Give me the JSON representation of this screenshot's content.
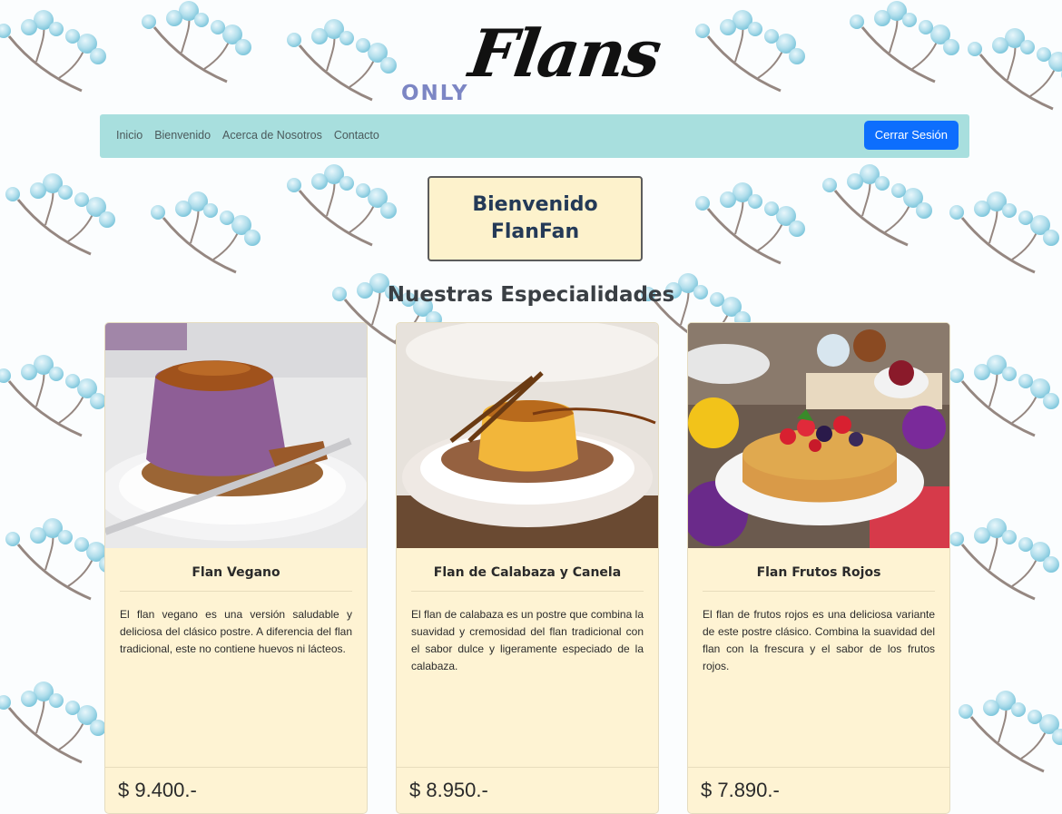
{
  "logo": {
    "prefix": "ONLY",
    "name": "Flans"
  },
  "nav": {
    "links": [
      "Inicio",
      "Bienvenido",
      "Acerca de Nosotros",
      "Contacto"
    ],
    "logout_label": "Cerrar Sesión"
  },
  "welcome": {
    "line1": "Bienvenido",
    "line2": "FlanFan"
  },
  "section_title": "Nuestras Especialidades",
  "cards": [
    {
      "title": "Flan Vegano",
      "text": "El flan vegano es una versión saludable y deliciosa del clásico postre. A diferencia del flan tradicional, este no contiene huevos ni lácteos.",
      "price": "$ 9.400.-"
    },
    {
      "title": "Flan de Calabaza y Canela",
      "text": "El flan de calabaza es un postre que combina la suavidad y cremosidad del flan tradicional con el sabor dulce y ligeramente especiado de la calabaza.",
      "price": "$ 8.950.-"
    },
    {
      "title": "Flan Frutos Rojos",
      "text": "El flan de frutos rojos es una deliciosa variante de este postre clásico. Combina la suavidad del flan con la frescura y el sabor de los frutos rojos.",
      "price": "$ 7.890.-"
    }
  ],
  "colors": {
    "navbar": "#a8dfde",
    "button": "#0d6efd",
    "card": "#fef3d3",
    "logo_prefix": "#7c86c4"
  }
}
